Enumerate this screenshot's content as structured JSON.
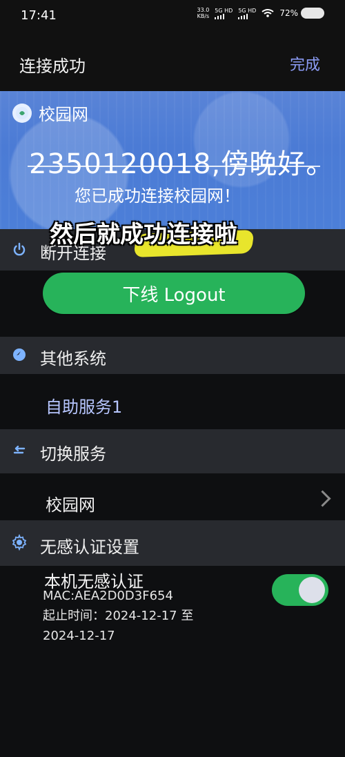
{
  "status_bar": {
    "time": "17:41",
    "net_speed_value": "33.0",
    "net_speed_unit": "KB/s",
    "signal_1": "5G HD",
    "signal_2": "5G HD",
    "battery": "72%"
  },
  "header": {
    "title": "连接成功",
    "done_label": "完成"
  },
  "hero": {
    "network_name": "校园网",
    "greeting": "2350120018,傍晚好。",
    "connected_message": "您已成功连接校园网！"
  },
  "overlay": {
    "caption": "然后就成功连接啦"
  },
  "disconnect": {
    "label": "断开连接",
    "logout_button": "下线 Logout"
  },
  "other_systems": {
    "label": "其他系统",
    "item": "自助服务1"
  },
  "switch_service": {
    "label": "切换服务",
    "item": "校园网"
  },
  "seamless_auth": {
    "label": "无感认证设置",
    "device_title": "本机无感认证",
    "mac": "MAC:AEA2D0D3F654",
    "period_1": "起止时间：2024-12-17 至",
    "period_2": "2024-12-17",
    "enabled": true
  },
  "colors": {
    "accent": "#27b35a",
    "link_blue": "#8c9cf6",
    "hero_blue": "#4b7bd5"
  },
  "icons": {
    "power": "power-icon",
    "other_system": "system-icon",
    "switch": "switch-icon",
    "settings": "gear-icon",
    "chevron": "chevron-right-icon"
  }
}
